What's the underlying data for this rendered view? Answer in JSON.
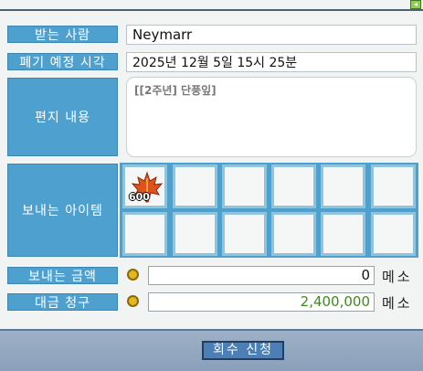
{
  "form": {
    "recipient_label": "받는 사람",
    "recipient_value": "Neymarr",
    "expiry_label": "폐기 예정 시각",
    "expiry_value": "2025년 12월 5일 15시 25분",
    "memo_label": "편지 내용",
    "memo_value": "[[2주년] 단풍잎]",
    "items_label": "보내는 아이템",
    "items": [
      {
        "icon": "maple-leaf-icon",
        "quantity": "600"
      },
      {},
      {},
      {},
      {},
      {},
      {},
      {},
      {},
      {},
      {},
      {}
    ],
    "send_amount_label": "보내는 금액",
    "send_amount_value": "0",
    "send_amount_unit": "메소",
    "cod_label": "대금 청구",
    "cod_value": "2,400,000",
    "cod_unit": "메소",
    "cod_color": "#3f8a1a"
  },
  "footer": {
    "submit_label": "회수 신청"
  }
}
